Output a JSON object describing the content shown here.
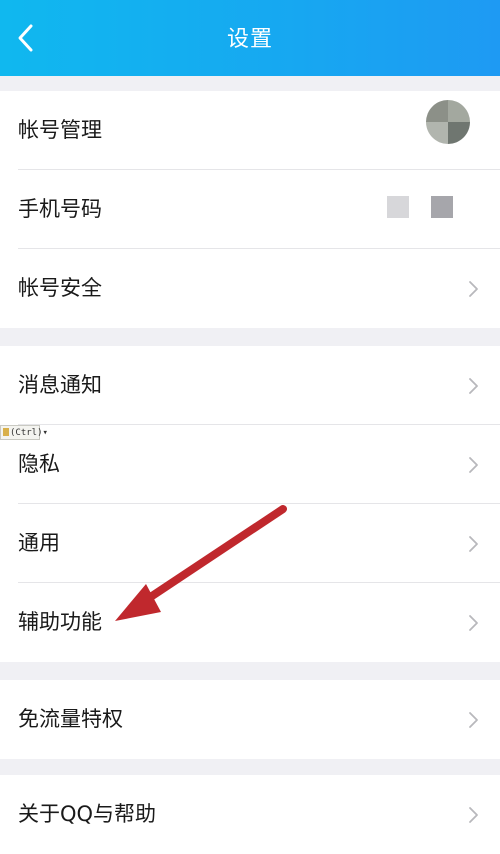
{
  "header": {
    "title": "设置",
    "back_icon": "chevron-left-icon"
  },
  "sections": [
    {
      "items": [
        {
          "label": "帐号管理",
          "trailing": "avatar"
        },
        {
          "label": "手机号码",
          "trailing": "blurred-number"
        },
        {
          "label": "帐号安全",
          "trailing": "chevron-right-icon"
        }
      ]
    },
    {
      "items": [
        {
          "label": "消息通知",
          "trailing": "chevron-right-icon"
        },
        {
          "label": "隐私",
          "trailing": "chevron-right-icon"
        },
        {
          "label": "通用",
          "trailing": "chevron-right-icon"
        },
        {
          "label": "辅助功能",
          "trailing": "chevron-right-icon"
        }
      ]
    },
    {
      "items": [
        {
          "label": "免流量特权",
          "trailing": "chevron-right-icon"
        }
      ]
    },
    {
      "items": [
        {
          "label": "关于QQ与帮助",
          "trailing": "chevron-right-icon"
        }
      ]
    }
  ],
  "overlay": {
    "ctrl_tag": "(Ctrl)",
    "annotation_arrow_color": "#c0282d",
    "annotation_arrow_target": "辅助功能"
  },
  "colors": {
    "header_start": "#10b8ef",
    "header_end": "#1e9af3",
    "background": "#f0f0f4",
    "chevron": "#b8b8bc"
  }
}
